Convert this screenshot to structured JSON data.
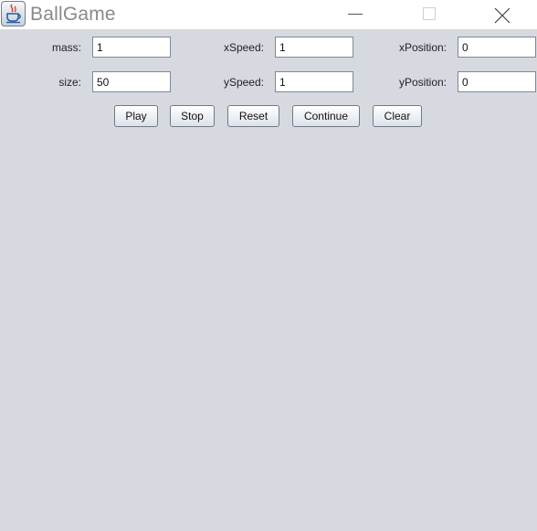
{
  "window": {
    "title": "BallGame",
    "icon": "java-cup-icon",
    "controls": [
      "minimize-icon",
      "maximize-icon",
      "close-icon"
    ]
  },
  "form": {
    "mass": {
      "label": "mass:",
      "value": "1"
    },
    "xSpeed": {
      "label": "xSpeed:",
      "value": "1"
    },
    "xPosition": {
      "label": "xPosition:",
      "value": "0"
    },
    "size": {
      "label": "size:",
      "value": "50"
    },
    "ySpeed": {
      "label": "ySpeed:",
      "value": "1"
    },
    "yPosition": {
      "label": "yPosition:",
      "value": "0"
    }
  },
  "buttons": {
    "play": "Play",
    "stop": "Stop",
    "reset": "Reset",
    "continue": "Continue",
    "clear": "Clear"
  },
  "colors": {
    "background": "#d6d9e0",
    "titlebar": "#ffffff",
    "title_text": "#8a8a8a"
  }
}
